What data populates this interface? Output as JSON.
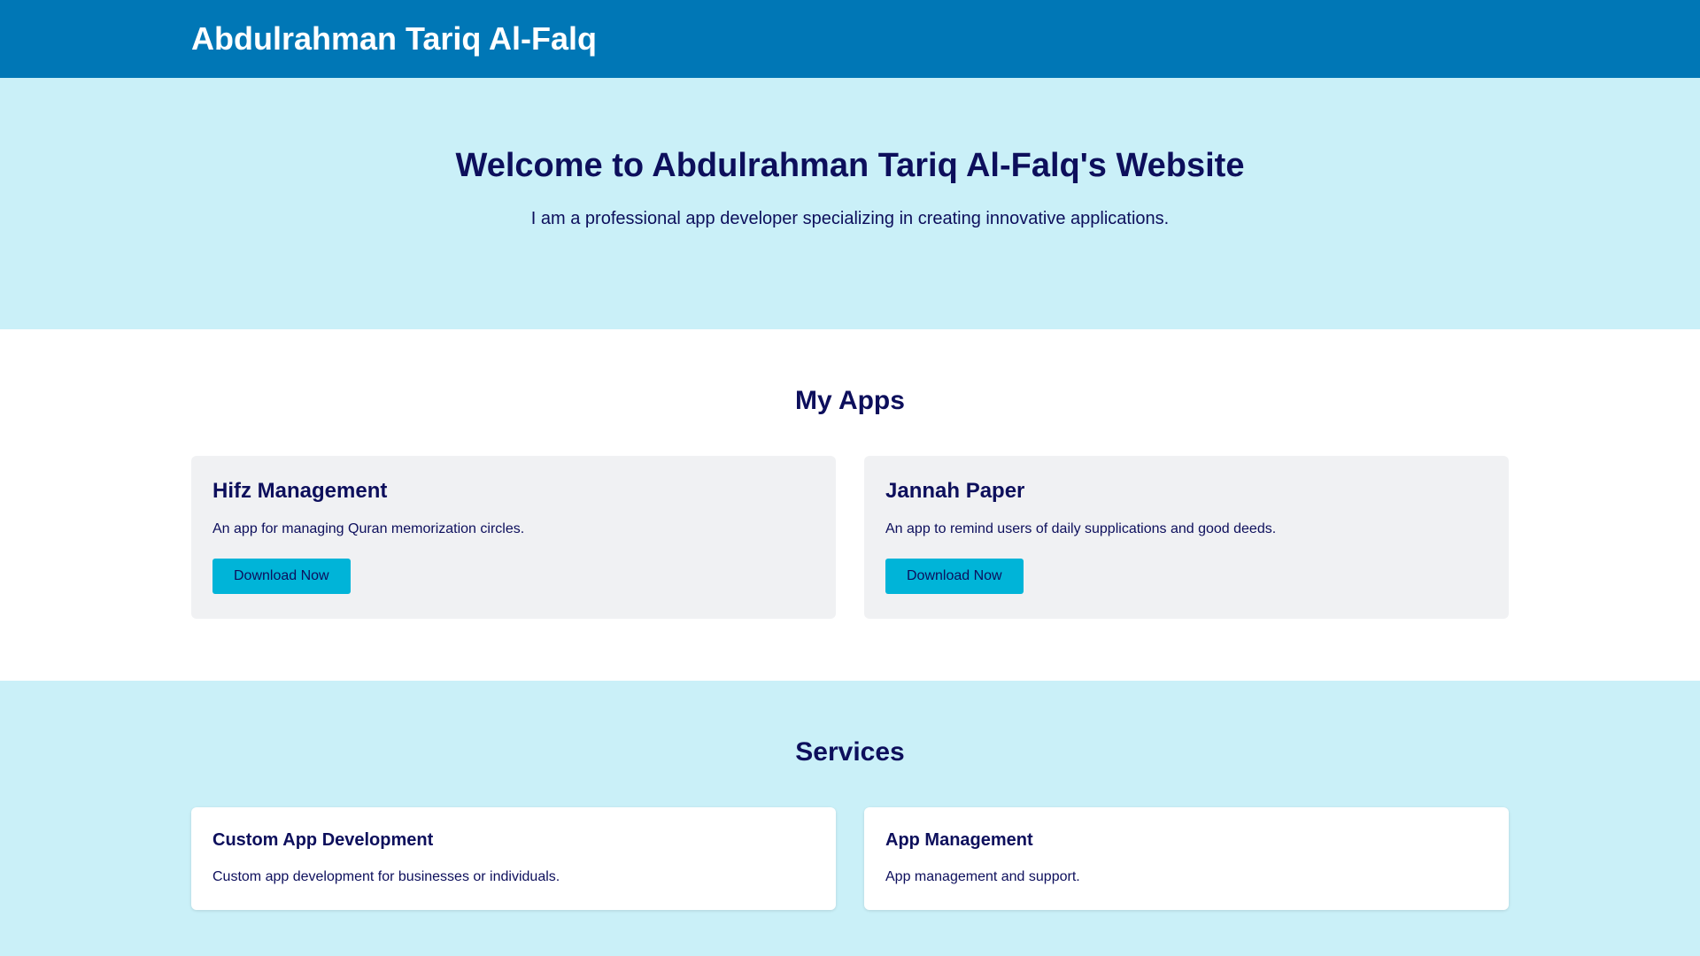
{
  "header": {
    "site_title": "Abdulrahman Tariq Al-Falq"
  },
  "hero": {
    "title": "Welcome to Abdulrahman Tariq Al-Falq's Website",
    "subtitle": "I am a professional app developer specializing in creating innovative applications."
  },
  "apps": {
    "section_title": "My Apps",
    "items": [
      {
        "name": "Hifz Management",
        "description": "An app for managing Quran memorization circles.",
        "button_label": "Download Now"
      },
      {
        "name": "Jannah Paper",
        "description": "An app to remind users of daily supplications and good deeds.",
        "button_label": "Download Now"
      }
    ]
  },
  "services": {
    "section_title": "Services",
    "items": [
      {
        "name": "Custom App Development",
        "description": "Custom app development for businesses or individuals."
      },
      {
        "name": "App Management",
        "description": "App management and support."
      }
    ]
  },
  "colors": {
    "header_bg": "#0077b6",
    "section_bg": "#caf0f8",
    "accent": "#00b4d8",
    "text": "#0d0f5c"
  }
}
